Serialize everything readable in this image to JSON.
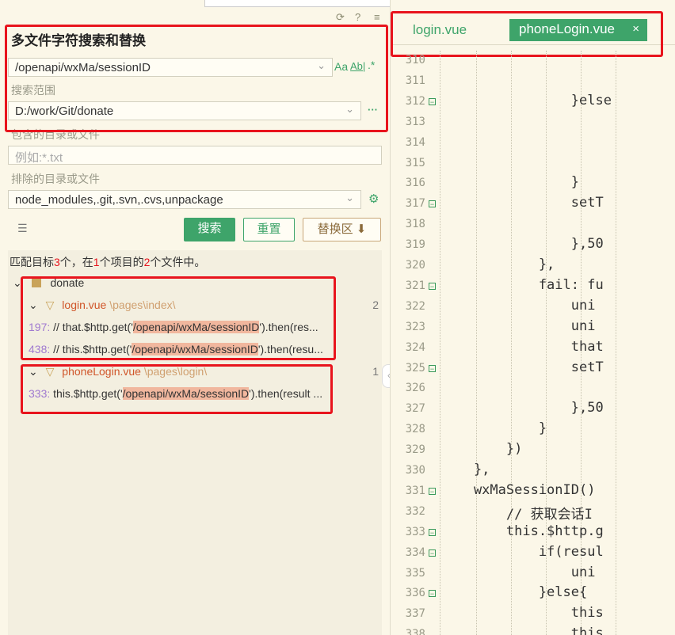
{
  "header": {
    "title": "多文件字符搜索和替换",
    "refresh_icon": "refresh-icon",
    "help_icon": "help-icon",
    "menu_icon": "menu-icon"
  },
  "search": {
    "query": "/openapi/wxMa/sessionID",
    "match_case": "Aa",
    "whole_word": "Ab|",
    "regex": ".*",
    "scope_label": "搜索范围",
    "scope_value": "D:/work/Git/donate",
    "more": "···",
    "include_label": "包含的目录或文件",
    "include_placeholder": "例如:*.txt",
    "exclude_label": "排除的目录或文件",
    "exclude_value": "node_modules,.git,.svn,.cvs,unpackage"
  },
  "buttons": {
    "search": "搜索",
    "reset": "重置",
    "replace": "替换区 ⬇"
  },
  "summary": {
    "prefix": "匹配目标",
    "targets": "3",
    "mid1": "个，在",
    "projects": "1",
    "mid2": "个项目的",
    "files": "2",
    "suffix": "个文件中。"
  },
  "tree": {
    "project": "donate",
    "files": [
      {
        "name": "login.vue",
        "path": "\\pages\\index\\",
        "count": "2",
        "matches": [
          {
            "line": "197:",
            "before": " // that.$http.get('",
            "match": "/openapi/wxMa/sessionID",
            "after": "').then(res..."
          },
          {
            "line": "438:",
            "before": " // this.$http.get('",
            "match": "/openapi/wxMa/sessionID",
            "after": "').then(resu..."
          }
        ]
      },
      {
        "name": "phoneLogin.vue",
        "path": "\\pages\\login\\",
        "count": "1",
        "matches": [
          {
            "line": "333:",
            "before": " this.$http.get('",
            "match": "/openapi/wxMa/sessionID",
            "after": "').then(result ..."
          }
        ]
      }
    ]
  },
  "editor": {
    "tabs": [
      {
        "label": "login.vue",
        "active": false
      },
      {
        "label": "phoneLogin.vue",
        "active": true,
        "close": "×"
      }
    ],
    "lines": [
      {
        "n": "310",
        "code": "",
        "fold": false
      },
      {
        "n": "311",
        "code": "",
        "fold": false
      },
      {
        "n": "312",
        "code": "                }else",
        "fold": true
      },
      {
        "n": "313",
        "code": "",
        "fold": false
      },
      {
        "n": "314",
        "code": "",
        "fold": false
      },
      {
        "n": "315",
        "code": "",
        "fold": false
      },
      {
        "n": "316",
        "code": "                }",
        "fold": false
      },
      {
        "n": "317",
        "code": "                setT",
        "fold": true
      },
      {
        "n": "318",
        "code": "",
        "fold": false
      },
      {
        "n": "319",
        "code": "                },50",
        "fold": false
      },
      {
        "n": "320",
        "code": "            },",
        "fold": false
      },
      {
        "n": "321",
        "code": "            fail: fu",
        "fold": true
      },
      {
        "n": "322",
        "code": "                uni",
        "fold": false
      },
      {
        "n": "323",
        "code": "                uni",
        "fold": false
      },
      {
        "n": "324",
        "code": "                that",
        "fold": false
      },
      {
        "n": "325",
        "code": "                setT",
        "fold": true
      },
      {
        "n": "326",
        "code": "",
        "fold": false
      },
      {
        "n": "327",
        "code": "                },50",
        "fold": false
      },
      {
        "n": "328",
        "code": "            }",
        "fold": false
      },
      {
        "n": "329",
        "code": "        })",
        "fold": false
      },
      {
        "n": "330",
        "code": "    },",
        "fold": false
      },
      {
        "n": "331",
        "code": "    wxMaSessionID()",
        "fold": true
      },
      {
        "n": "332",
        "code": "        // 获取会话I",
        "fold": false
      },
      {
        "n": "333",
        "code": "        this.$http.g",
        "fold": true
      },
      {
        "n": "334",
        "code": "            if(resul",
        "fold": true
      },
      {
        "n": "335",
        "code": "                uni",
        "fold": false
      },
      {
        "n": "336",
        "code": "            }else{",
        "fold": true
      },
      {
        "n": "337",
        "code": "                this",
        "fold": false
      },
      {
        "n": "338",
        "code": "                this",
        "fold": false
      }
    ]
  },
  "colors": {
    "accent": "#3ea46a",
    "highlight": "#f1b79e",
    "annotation": "#e8141d",
    "number": "#e8141d"
  }
}
